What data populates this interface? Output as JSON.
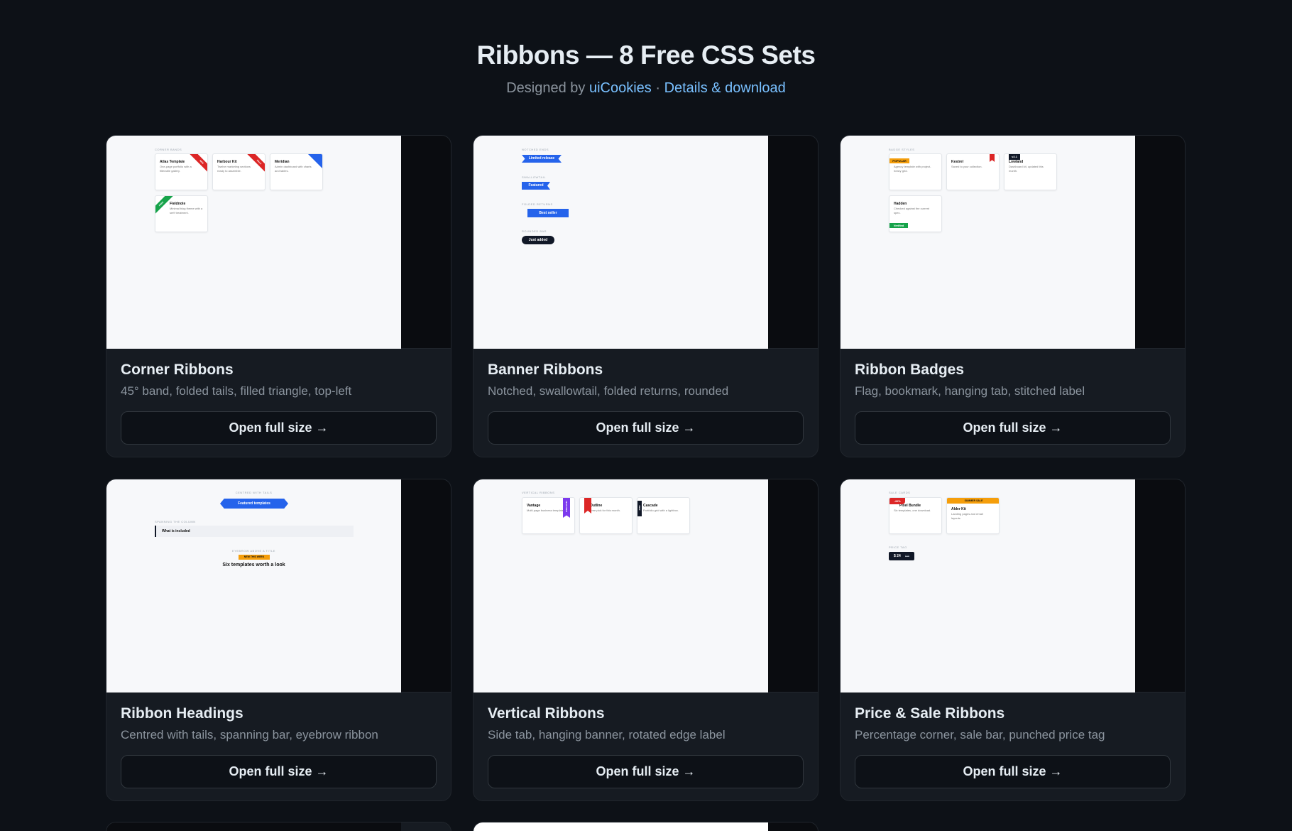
{
  "header": {
    "title": "Ribbons — 8 Free CSS Sets",
    "designed_by_prefix": "Designed by ",
    "designer_link": "uiCookies",
    "separator": " · ",
    "details_link": "Details & download"
  },
  "cards": [
    {
      "title": "Corner Ribbons",
      "description": "45° band, folded tails, filled triangle, top-left",
      "button": "Open full size →",
      "preview": {
        "section_label": "CORNER BANDS",
        "items": [
          {
            "title": "Atlas Template",
            "text": "One-page portfolio with a filterable gallery.",
            "ribbon": "NEW"
          },
          {
            "title": "Harbour Kit",
            "text": "Twelve marketing sections ready to assemble.",
            "ribbon": "SALE"
          },
          {
            "title": "Meridian",
            "text": "Admin dashboard with charts and tables.",
            "ribbon": "HOT"
          },
          {
            "title": "Fieldnote",
            "text": "Minimal blog theme with a serif treatment.",
            "ribbon": "FREE"
          }
        ]
      }
    },
    {
      "title": "Banner Ribbons",
      "description": "Notched, swallowtail, folded returns, rounded",
      "button": "Open full size →",
      "preview": {
        "labels": [
          "NOTCHED ENDS",
          "SWALLOWTAIL",
          "FOLDED RETURNS",
          "ROUNDED BAR"
        ],
        "ribbons": [
          "Limited release",
          "Featured",
          "Best seller",
          "Just added"
        ]
      }
    },
    {
      "title": "Ribbon Badges",
      "description": "Flag, bookmark, hanging tab, stitched label",
      "button": "Open full size →",
      "preview": {
        "section_label": "BADGE STYLES",
        "items": [
          {
            "title": "POPULAR",
            "text": "Agency template with project-heavy grid."
          },
          {
            "title": "Kestrel",
            "text": "Saved to your collection."
          },
          {
            "title": "Lowland",
            "text": "Dashboard kit, updated this month.",
            "tab": "v2.1"
          },
          {
            "title": "Hadden",
            "text": "Checked against the current spec.",
            "badge": "Verified"
          }
        ]
      }
    },
    {
      "title": "Ribbon Headings",
      "description": "Centred with tails, spanning bar, eyebrow ribbon",
      "button": "Open full size →",
      "preview": {
        "labels": [
          "CENTRED WITH TAILS",
          "SPANNING THE COLUMN",
          "EYEBROW ABOVE A TITLE"
        ],
        "centred": "Featured templates",
        "spanning": "What is included",
        "eyebrow": "NEW THIS WEEK",
        "heading": "Six templates worth a look"
      }
    },
    {
      "title": "Vertical Ribbons",
      "description": "Side tab, hanging banner, rotated edge label",
      "button": "Open full size →",
      "preview": {
        "section_label": "VERTICAL RIBBONS",
        "items": [
          {
            "title": "Vantage",
            "text": "Multi-page business template.",
            "ribbon": "FEATURED"
          },
          {
            "title": "Outline",
            "text": "Free pick for this month."
          },
          {
            "title": "Cascade",
            "text": "Portfolio grid with a lightbox.",
            "ribbon": "NEW"
          }
        ]
      }
    },
    {
      "title": "Price & Sale Ribbons",
      "description": "Percentage corner, sale bar, punched price tag",
      "button": "Open full size →",
      "preview": {
        "labels": [
          "SALE CARDS",
          "PRICE TAG"
        ],
        "items": [
          {
            "title": "Pixel Bundle",
            "text": "Six templates, one download.",
            "ribbon": "-40%"
          },
          {
            "title": "Alder Kit",
            "text": "Landing pages and email layouts.",
            "ribbon": "SUMMER SALE"
          }
        ],
        "price": "$ 24",
        "old_price": "$49"
      }
    }
  ],
  "colors": {
    "background": "#0d1117",
    "card": "#161b22",
    "link": "#79c0ff",
    "ribbon_red": "#dc2626",
    "ribbon_blue": "#2563eb",
    "ribbon_green": "#16a34a",
    "ribbon_amber": "#f59e0b",
    "ribbon_purple": "#7c3aed"
  }
}
